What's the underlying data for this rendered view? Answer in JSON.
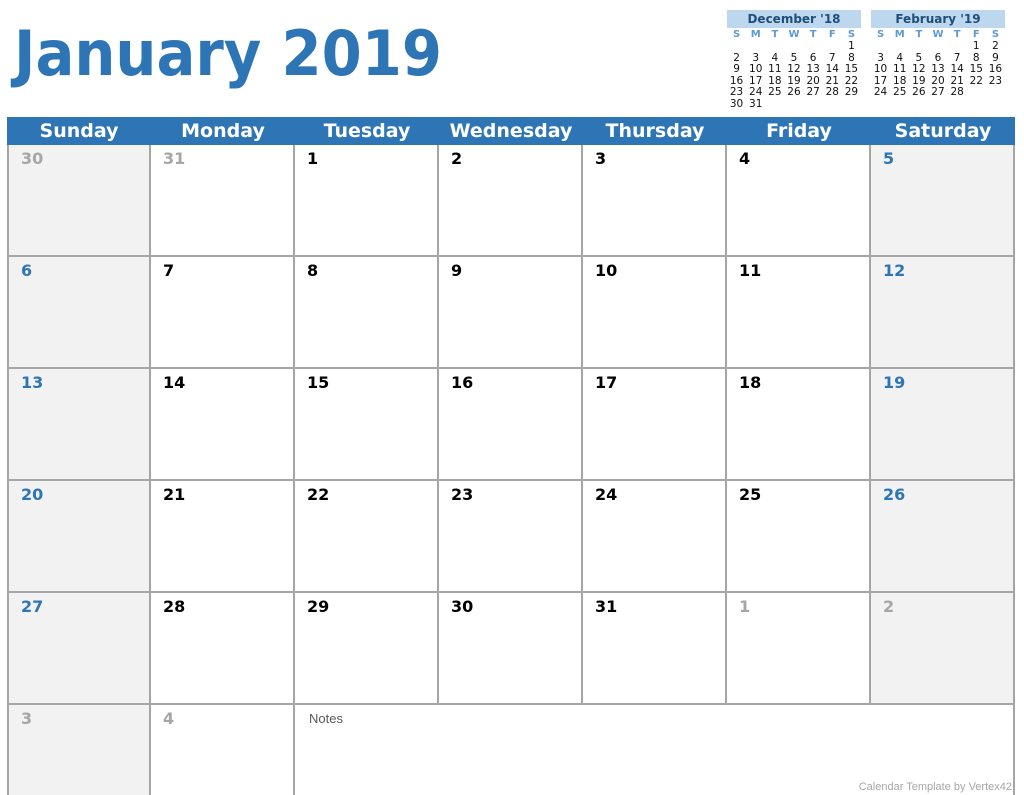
{
  "title": "January 2019",
  "mini_calendars": [
    {
      "title": "December '18",
      "dow": [
        "S",
        "M",
        "T",
        "W",
        "T",
        "F",
        "S"
      ],
      "weeks": [
        [
          "",
          "",
          "",
          "",
          "",
          "",
          "1"
        ],
        [
          "2",
          "3",
          "4",
          "5",
          "6",
          "7",
          "8"
        ],
        [
          "9",
          "10",
          "11",
          "12",
          "13",
          "14",
          "15"
        ],
        [
          "16",
          "17",
          "18",
          "19",
          "20",
          "21",
          "22"
        ],
        [
          "23",
          "24",
          "25",
          "26",
          "27",
          "28",
          "29"
        ],
        [
          "30",
          "31",
          "",
          "",
          "",
          "",
          ""
        ]
      ]
    },
    {
      "title": "February '19",
      "dow": [
        "S",
        "M",
        "T",
        "W",
        "T",
        "F",
        "S"
      ],
      "weeks": [
        [
          "",
          "",
          "",
          "",
          "",
          "1",
          "2"
        ],
        [
          "3",
          "4",
          "5",
          "6",
          "7",
          "8",
          "9"
        ],
        [
          "10",
          "11",
          "12",
          "13",
          "14",
          "15",
          "16"
        ],
        [
          "17",
          "18",
          "19",
          "20",
          "21",
          "22",
          "23"
        ],
        [
          "24",
          "25",
          "26",
          "27",
          "28",
          "",
          ""
        ]
      ]
    }
  ],
  "weekdays": [
    "Sunday",
    "Monday",
    "Tuesday",
    "Wednesday",
    "Thursday",
    "Friday",
    "Saturday"
  ],
  "weeks": [
    [
      {
        "d": "30",
        "t": "out"
      },
      {
        "d": "31",
        "t": "out"
      },
      {
        "d": "1",
        "t": ""
      },
      {
        "d": "2",
        "t": ""
      },
      {
        "d": "3",
        "t": ""
      },
      {
        "d": "4",
        "t": ""
      },
      {
        "d": "5",
        "t": "wk"
      }
    ],
    [
      {
        "d": "6",
        "t": "wk"
      },
      {
        "d": "7",
        "t": ""
      },
      {
        "d": "8",
        "t": ""
      },
      {
        "d": "9",
        "t": ""
      },
      {
        "d": "10",
        "t": ""
      },
      {
        "d": "11",
        "t": ""
      },
      {
        "d": "12",
        "t": "wk"
      }
    ],
    [
      {
        "d": "13",
        "t": "wk"
      },
      {
        "d": "14",
        "t": ""
      },
      {
        "d": "15",
        "t": ""
      },
      {
        "d": "16",
        "t": ""
      },
      {
        "d": "17",
        "t": ""
      },
      {
        "d": "18",
        "t": ""
      },
      {
        "d": "19",
        "t": "wk"
      }
    ],
    [
      {
        "d": "20",
        "t": "wk"
      },
      {
        "d": "21",
        "t": ""
      },
      {
        "d": "22",
        "t": ""
      },
      {
        "d": "23",
        "t": ""
      },
      {
        "d": "24",
        "t": ""
      },
      {
        "d": "25",
        "t": ""
      },
      {
        "d": "26",
        "t": "wk"
      }
    ],
    [
      {
        "d": "27",
        "t": "wk"
      },
      {
        "d": "28",
        "t": ""
      },
      {
        "d": "29",
        "t": ""
      },
      {
        "d": "30",
        "t": ""
      },
      {
        "d": "31",
        "t": ""
      },
      {
        "d": "1",
        "t": "out"
      },
      {
        "d": "2",
        "t": "out"
      }
    ]
  ],
  "last_row": [
    {
      "d": "3",
      "t": "out"
    },
    {
      "d": "4",
      "t": "out"
    }
  ],
  "notes_label": "Notes",
  "footer": "Calendar Template by Vertex42"
}
